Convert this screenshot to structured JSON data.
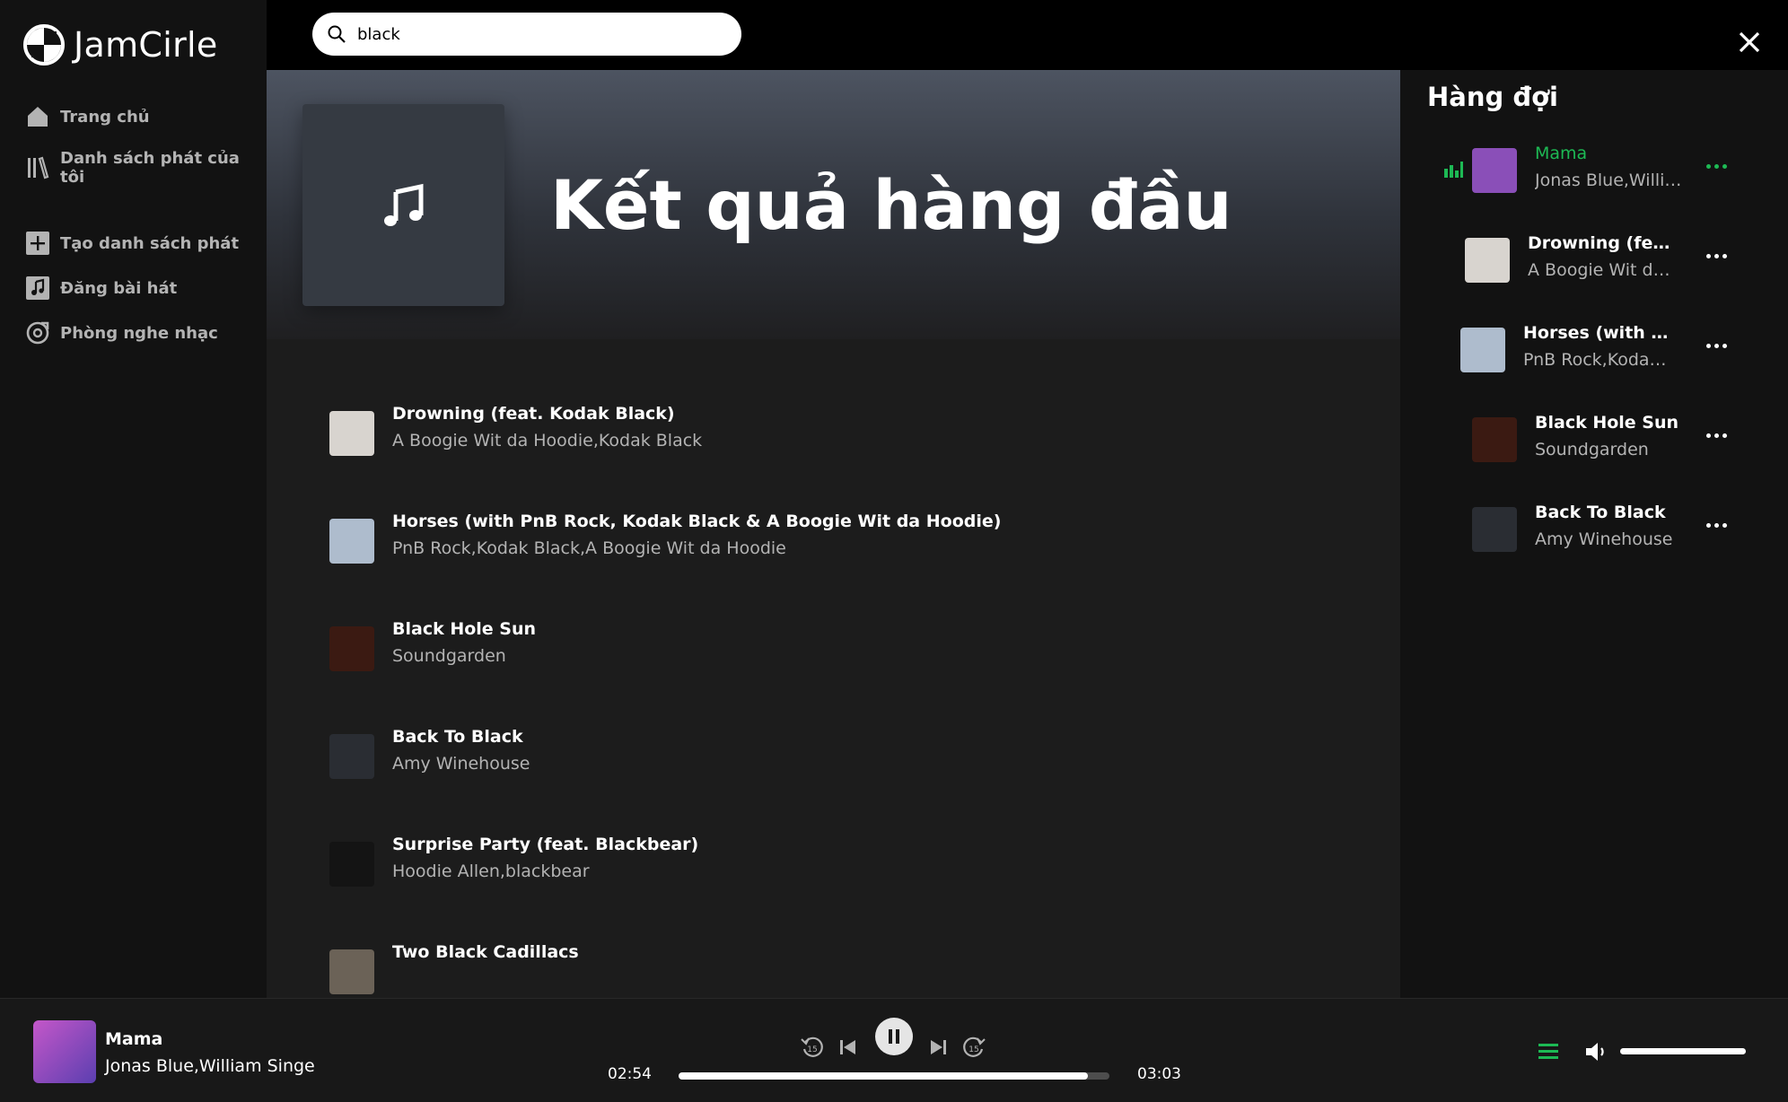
{
  "app": {
    "name": "JamCirle"
  },
  "sidebar": {
    "items": [
      {
        "label": "Trang chủ",
        "icon": "home-icon"
      },
      {
        "label": "Danh sách phát của tôi",
        "icon": "library-icon"
      },
      {
        "label": "Tạo danh sách phát",
        "icon": "plus-square-icon"
      },
      {
        "label": "Đăng bài hát",
        "icon": "music-note-icon"
      },
      {
        "label": "Phòng nghe nhạc",
        "icon": "listening-room-icon"
      }
    ]
  },
  "search": {
    "value": "black",
    "placeholder": ""
  },
  "hero": {
    "title": "Kết quả hàng đầu",
    "icon": "music-note-icon"
  },
  "results": [
    {
      "title": "Drowning (feat. Kodak Black)",
      "artist": "A Boogie Wit da Hoodie,Kodak Black",
      "thumb_color": "#d8d4cf"
    },
    {
      "title": "Horses (with PnB Rock, Kodak Black & A Boogie Wit da Hoodie)",
      "artist": "PnB Rock,Kodak Black,A Boogie Wit da Hoodie",
      "thumb_color": "#aebccd"
    },
    {
      "title": "Black Hole Sun",
      "artist": "Soundgarden",
      "thumb_color": "#3b1a12"
    },
    {
      "title": "Back To Black",
      "artist": "Amy Winehouse",
      "thumb_color": "#2a2d33"
    },
    {
      "title": "Surprise Party (feat. Blackbear)",
      "artist": "Hoodie Allen,blackbear",
      "thumb_color": "#141414"
    },
    {
      "title": "Two Black Cadillacs",
      "artist": "",
      "thumb_color": "#6b6257"
    }
  ],
  "queue": {
    "title": "Hàng đợi",
    "items": [
      {
        "title": "Mama",
        "artist": "Jonas Blue,William Singe",
        "playing": true,
        "thumb_color": "#8a4fb8"
      },
      {
        "title": "Drowning (feat. Kodak Black)",
        "artist": "A Boogie Wit da Hoodie,Kodak Black",
        "playing": false,
        "thumb_color": "#d8d4cf"
      },
      {
        "title": "Horses (with PnB Rock, Kodak Black & A Boogie Wit da Hoodie)",
        "artist": "PnB Rock,Kodak Black,A Boogie Wit da Hoodie",
        "playing": false,
        "thumb_color": "#aebccd"
      },
      {
        "title": "Black Hole Sun",
        "artist": "Soundgarden",
        "playing": false,
        "thumb_color": "#3b1a12"
      },
      {
        "title": "Back To Black",
        "artist": "Amy Winehouse",
        "playing": false,
        "thumb_color": "#2a2d33"
      }
    ]
  },
  "player": {
    "title": "Mama",
    "artist": "Jonas Blue,William Singe",
    "current_time": "02:54",
    "duration": "03:03",
    "progress": 0.95,
    "volume": 1.0,
    "art_color": "#8a4fb8"
  },
  "colors": {
    "accent": "#1db954",
    "sidebar_bg": "#121212",
    "main_bg": "#1c1c1c"
  }
}
